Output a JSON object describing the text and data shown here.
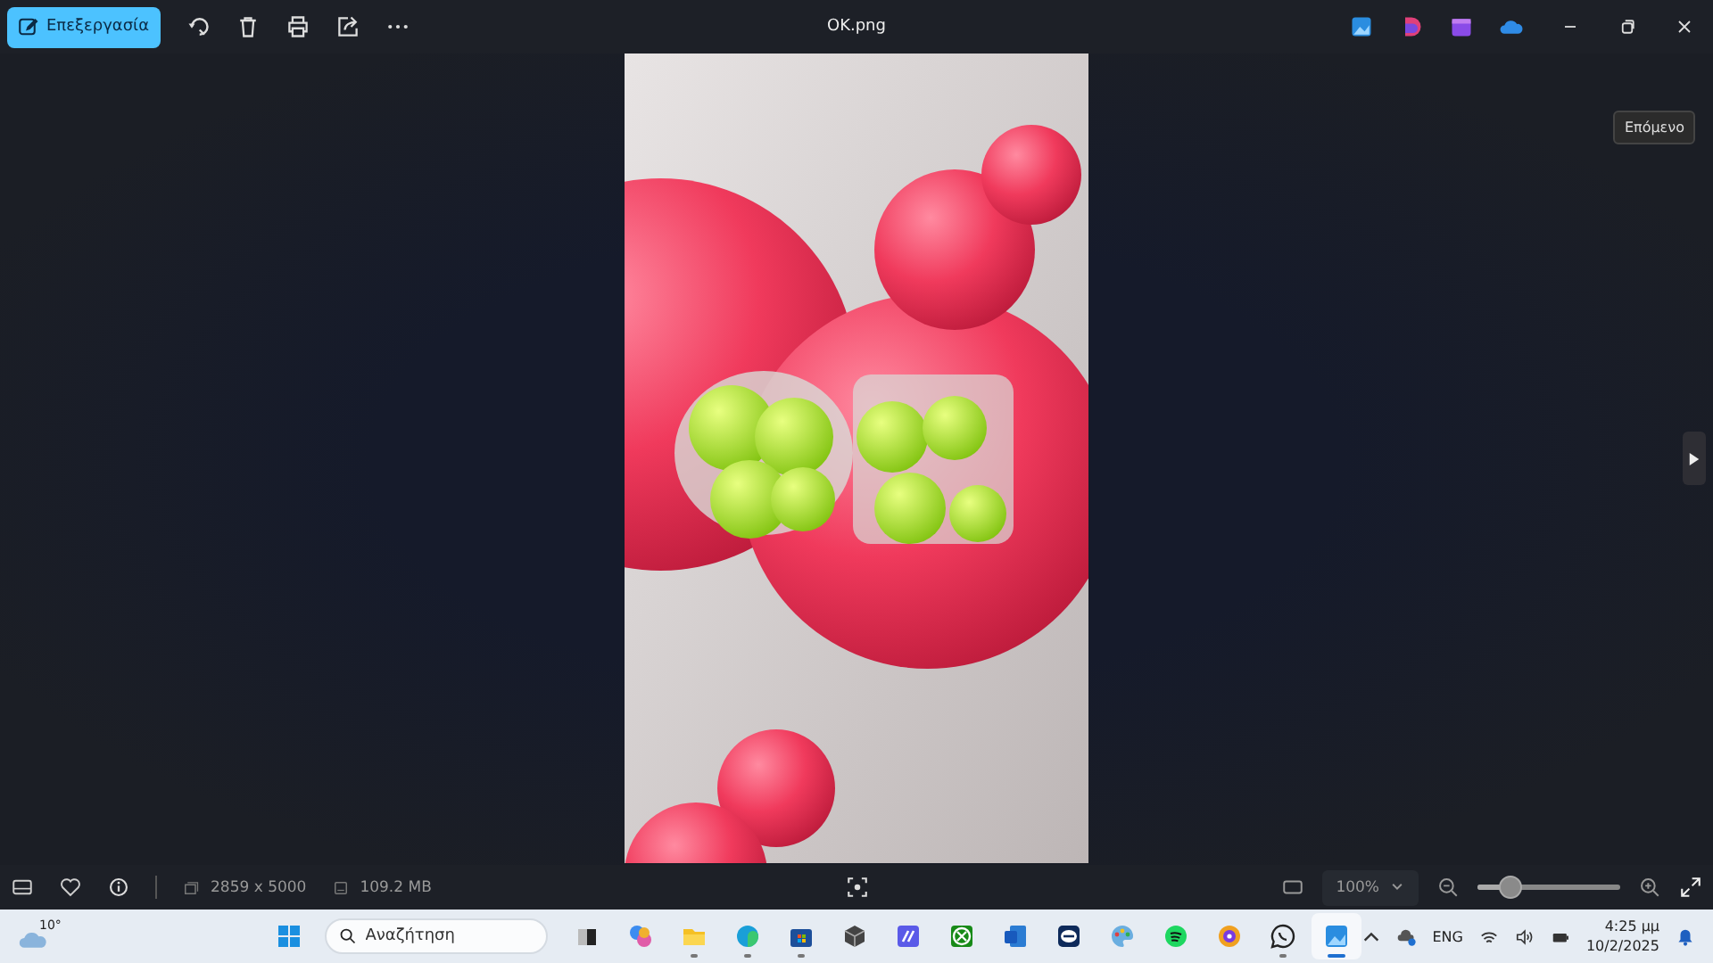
{
  "window": {
    "title": "OK.png"
  },
  "toolbar": {
    "edit_button": "Επεξεργασία"
  },
  "tooltip": "Επόμενο",
  "status_bar": {
    "dimensions": "2859 x 5000",
    "file_size": "109.2 MB",
    "zoom": "100%",
    "zoom_slider": {
      "level": 0.17
    }
  },
  "taskbar": {
    "weather": "10°",
    "search": {
      "placeholder": "Αναζήτηση"
    },
    "apps": [
      {
        "kind": "start",
        "running": false,
        "active": false
      },
      {
        "kind": "taskview",
        "running": false,
        "active": false
      },
      {
        "kind": "copilot",
        "running": false,
        "active": false
      },
      {
        "kind": "folder",
        "running": true,
        "active": false
      },
      {
        "kind": "edge",
        "running": true,
        "active": false
      },
      {
        "kind": "store",
        "running": true,
        "active": false
      },
      {
        "kind": "cube",
        "running": false,
        "active": false
      },
      {
        "kind": "pen",
        "running": false,
        "active": false
      },
      {
        "kind": "xbox",
        "running": false,
        "active": false
      },
      {
        "kind": "word",
        "running": false,
        "active": false
      },
      {
        "kind": "remote",
        "running": false,
        "active": false
      },
      {
        "kind": "palette",
        "running": false,
        "active": false
      },
      {
        "kind": "music",
        "running": false,
        "active": false
      },
      {
        "kind": "shield",
        "running": false,
        "active": false
      },
      {
        "kind": "chat",
        "running": true,
        "active": false
      },
      {
        "kind": "photos",
        "running": true,
        "active": true
      }
    ],
    "language": "ENG",
    "time": "4:25 μμ",
    "date": "10/2/2025"
  }
}
